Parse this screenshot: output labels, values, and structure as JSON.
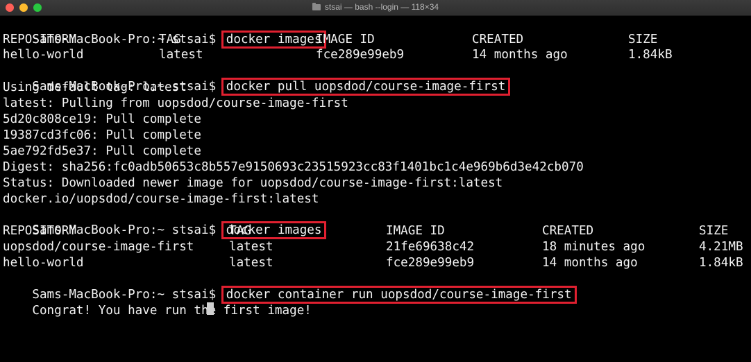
{
  "window": {
    "title": "stsai — bash --login — 118×34",
    "icon": "folder-icon",
    "colors": {
      "background": "#000000",
      "text": "#f2f2f2",
      "highlight": "#e02030"
    }
  },
  "prompt": "Sams-MacBook-Pro:~ stsai$",
  "commands": {
    "c1": "docker images",
    "c2": "docker pull uopsdod/course-image-first",
    "c3": "docker images",
    "c4": "docker container run uopsdod/course-image-first"
  },
  "table1": {
    "headers": [
      "REPOSITORY",
      "TAG",
      "IMAGE ID",
      "CREATED",
      "SIZE"
    ],
    "rows": [
      [
        "hello-world",
        "latest",
        "fce289e99eb9",
        "14 months ago",
        "1.84kB"
      ]
    ]
  },
  "pull_output": [
    "Using default tag: latest",
    "latest: Pulling from uopsdod/course-image-first",
    "5d20c808ce19: Pull complete",
    "19387cd3fc06: Pull complete",
    "5ae792fd5e37: Pull complete",
    "Digest: sha256:fc0adb50653c8b557e9150693c23515923cc83f1401bc1c4e969b6d3e42cb070",
    "Status: Downloaded newer image for uopsdod/course-image-first:latest",
    "docker.io/uopsdod/course-image-first:latest"
  ],
  "table2": {
    "headers": [
      "REPOSITORY",
      "TAG",
      "IMAGE ID",
      "CREATED",
      "SIZE"
    ],
    "rows": [
      [
        "uopsdod/course-image-first",
        "latest",
        "21fe69638c42",
        "18 minutes ago",
        "4.21MB"
      ],
      [
        "hello-world",
        "latest",
        "fce289e99eb9",
        "14 months ago",
        "1.84kB"
      ]
    ]
  },
  "run_output": "Congrat! You have run the first image!"
}
